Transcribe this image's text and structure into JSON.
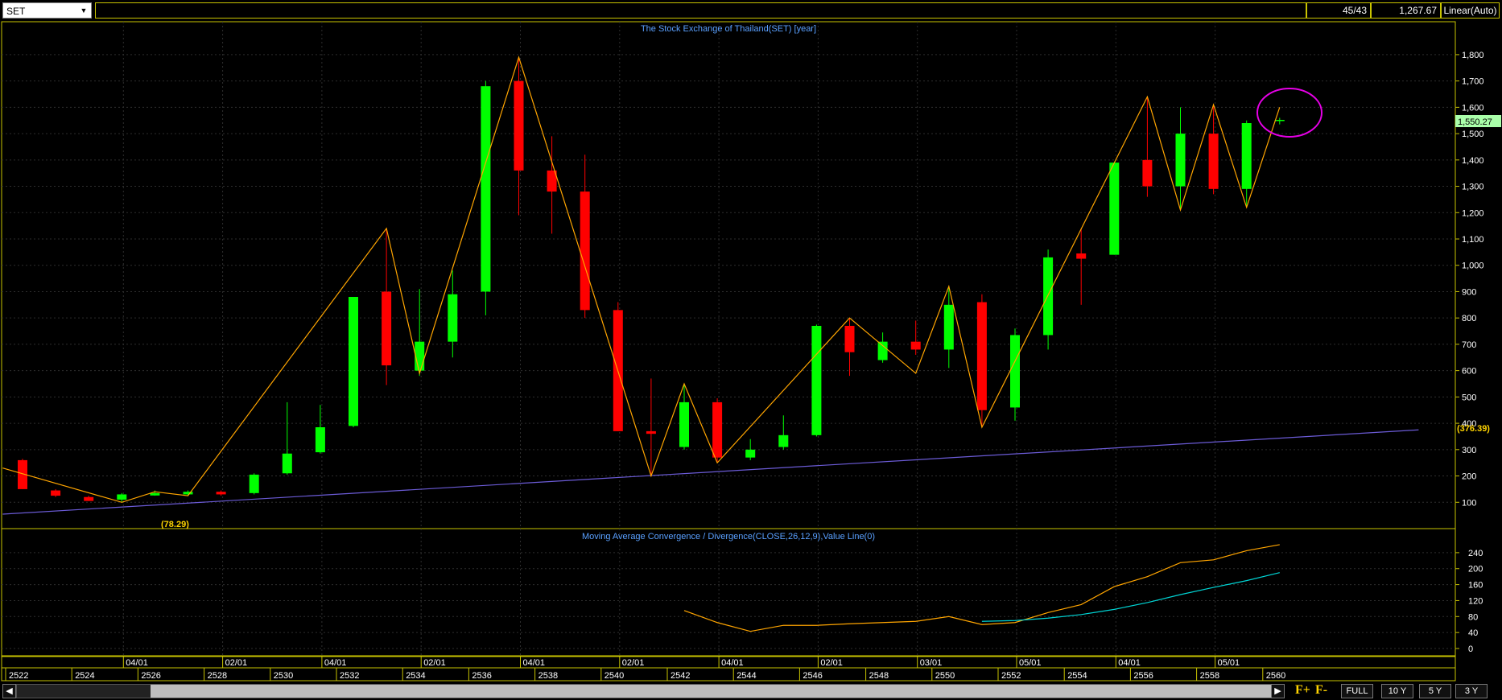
{
  "toolbar": {
    "symbol": "SET",
    "count": "45/43",
    "value": "1,267.67",
    "scale": "Linear(Auto)"
  },
  "chart_data": [
    {
      "type": "candlestick",
      "title": "The Stock Exchange of Thailand(SET) [year]",
      "x_labels_year": [
        "2522",
        "2524",
        "2526",
        "2528",
        "2530",
        "2532",
        "2534",
        "2536",
        "2538",
        "2540",
        "2542",
        "2544",
        "2546",
        "2548",
        "2550",
        "2552",
        "2554",
        "2556",
        "2558",
        "2560"
      ],
      "x_labels_date": [
        "04/01",
        "02/01",
        "04/01",
        "02/01",
        "04/01",
        "02/01",
        "04/01",
        "02/01",
        "03/01",
        "05/01",
        "04/01",
        "05/01"
      ],
      "y_ticks": [
        100,
        200,
        300,
        400,
        500,
        600,
        700,
        800,
        900,
        1000,
        1100,
        1200,
        1300,
        1400,
        1500,
        1600,
        1700,
        1800
      ],
      "ylim": [
        0,
        1870
      ],
      "candles": [
        {
          "year": 2522,
          "open": 260,
          "high": 265,
          "low": 150,
          "close": 150
        },
        {
          "year": 2523,
          "open": 145,
          "high": 150,
          "low": 120,
          "close": 125
        },
        {
          "year": 2524,
          "open": 120,
          "high": 125,
          "low": 105,
          "close": 105
        },
        {
          "year": 2525,
          "open": 110,
          "high": 135,
          "low": 100,
          "close": 130
        },
        {
          "year": 2526,
          "open": 130,
          "high": 145,
          "low": 125,
          "close": 135
        },
        {
          "year": 2527,
          "open": 130,
          "high": 145,
          "low": 125,
          "close": 140
        },
        {
          "year": 2528,
          "open": 140,
          "high": 145,
          "low": 125,
          "close": 130
        },
        {
          "year": 2529,
          "open": 135,
          "high": 210,
          "low": 130,
          "close": 205
        },
        {
          "year": 2530,
          "open": 210,
          "high": 480,
          "low": 205,
          "close": 285
        },
        {
          "year": 2531,
          "open": 290,
          "high": 470,
          "low": 285,
          "close": 385
        },
        {
          "year": 2532,
          "open": 390,
          "high": 880,
          "low": 385,
          "close": 880
        },
        {
          "year": 2533,
          "open": 900,
          "high": 1140,
          "low": 545,
          "close": 620
        },
        {
          "year": 2534,
          "open": 600,
          "high": 910,
          "low": 580,
          "close": 710
        },
        {
          "year": 2535,
          "open": 710,
          "high": 980,
          "low": 650,
          "close": 890
        },
        {
          "year": 2536,
          "open": 900,
          "high": 1700,
          "low": 810,
          "close": 1680
        },
        {
          "year": 2537,
          "open": 1700,
          "high": 1790,
          "low": 1190,
          "close": 1360
        },
        {
          "year": 2538,
          "open": 1360,
          "high": 1490,
          "low": 1120,
          "close": 1280
        },
        {
          "year": 2539,
          "open": 1280,
          "high": 1420,
          "low": 800,
          "close": 830
        },
        {
          "year": 2540,
          "open": 830,
          "high": 860,
          "low": 370,
          "close": 370
        },
        {
          "year": 2541,
          "open": 370,
          "high": 570,
          "low": 200,
          "close": 360
        },
        {
          "year": 2542,
          "open": 310,
          "high": 550,
          "low": 300,
          "close": 480
        },
        {
          "year": 2543,
          "open": 480,
          "high": 495,
          "low": 250,
          "close": 270
        },
        {
          "year": 2544,
          "open": 270,
          "high": 340,
          "low": 260,
          "close": 300
        },
        {
          "year": 2545,
          "open": 310,
          "high": 430,
          "low": 300,
          "close": 355
        },
        {
          "year": 2546,
          "open": 355,
          "high": 775,
          "low": 350,
          "close": 770
        },
        {
          "year": 2547,
          "open": 770,
          "high": 800,
          "low": 580,
          "close": 670
        },
        {
          "year": 2548,
          "open": 640,
          "high": 745,
          "low": 630,
          "close": 710
        },
        {
          "year": 2549,
          "open": 710,
          "high": 790,
          "low": 660,
          "close": 680
        },
        {
          "year": 2550,
          "open": 680,
          "high": 920,
          "low": 610,
          "close": 850
        },
        {
          "year": 2551,
          "open": 860,
          "high": 890,
          "low": 385,
          "close": 450
        },
        {
          "year": 2552,
          "open": 460,
          "high": 760,
          "low": 410,
          "close": 735
        },
        {
          "year": 2553,
          "open": 735,
          "high": 1060,
          "low": 680,
          "close": 1030
        },
        {
          "year": 2554,
          "open": 1045,
          "high": 1140,
          "low": 850,
          "close": 1025
        },
        {
          "year": 2555,
          "open": 1040,
          "high": 1390,
          "low": 1040,
          "close": 1390
        },
        {
          "year": 2556,
          "open": 1400,
          "high": 1640,
          "low": 1260,
          "close": 1300
        },
        {
          "year": 2557,
          "open": 1300,
          "high": 1600,
          "low": 1210,
          "close": 1500
        },
        {
          "year": 2558,
          "open": 1500,
          "high": 1610,
          "low": 1270,
          "close": 1290
        },
        {
          "year": 2559,
          "open": 1290,
          "high": 1550,
          "low": 1220,
          "close": 1540
        },
        {
          "year": 2560,
          "open": 1545,
          "high": 1560,
          "low": 1535,
          "close": 1550
        }
      ],
      "zigzag": [
        [
          2521.4,
          230
        ],
        [
          2525,
          100
        ],
        [
          2526,
          140
        ],
        [
          2527,
          125
        ],
        [
          2533,
          1140
        ],
        [
          2534,
          590
        ],
        [
          2537,
          1790
        ],
        [
          2541,
          200
        ],
        [
          2542,
          550
        ],
        [
          2543,
          250
        ],
        [
          2547,
          800
        ],
        [
          2549,
          590
        ],
        [
          2550,
          920
        ],
        [
          2551,
          385
        ],
        [
          2556,
          1640
        ],
        [
          2557,
          1210
        ],
        [
          2558,
          1610
        ],
        [
          2559,
          1220
        ],
        [
          2560,
          1600
        ]
      ],
      "trendline": {
        "start": [
          2521.4,
          55
        ],
        "end": [
          2564.2,
          375
        ]
      },
      "annotations": [
        "(78.29)",
        "(376.39)"
      ],
      "last_value_label": "1,550.27",
      "highlight": "ellipse around year 2560 candle",
      "colors": {
        "up": "#00ff00",
        "down": "#ff0000",
        "zigzag": "#ffa500",
        "trend": "#6b5bd6",
        "grid": "#333333",
        "axis_text": "#ffffff",
        "title": "#5aa0ff"
      }
    },
    {
      "type": "line",
      "title": "Moving Average Convergence / Divergence(CLOSE,26,12,9),Value Line(0)",
      "y_ticks": [
        0,
        40,
        80,
        120,
        160,
        200,
        240
      ],
      "ylim": [
        0,
        270
      ],
      "series": [
        {
          "color": "#ffa500",
          "points": [
            [
              2542,
              95
            ],
            [
              2543,
              65
            ],
            [
              2544,
              43
            ],
            [
              2545,
              58
            ],
            [
              2546,
              58
            ],
            [
              2547,
              62
            ],
            [
              2548,
              65
            ],
            [
              2549,
              68
            ],
            [
              2550,
              80
            ],
            [
              2551,
              60
            ],
            [
              2552,
              65
            ],
            [
              2553,
              90
            ],
            [
              2554,
              110
            ],
            [
              2555,
              155
            ],
            [
              2556,
              180
            ],
            [
              2557,
              215
            ],
            [
              2558,
              222
            ],
            [
              2559,
              245
            ],
            [
              2560,
              260
            ]
          ]
        },
        {
          "color": "#00d5d5",
          "points": [
            [
              2551,
              68
            ],
            [
              2552,
              70
            ],
            [
              2553,
              76
            ],
            [
              2554,
              85
            ],
            [
              2555,
              98
            ],
            [
              2556,
              115
            ],
            [
              2557,
              135
            ],
            [
              2558,
              153
            ],
            [
              2559,
              170
            ],
            [
              2560,
              190
            ]
          ]
        }
      ]
    }
  ],
  "nav": {
    "full": "FULL",
    "ten_y": "10 Y",
    "five_y": "5 Y",
    "three_y": "3 Y",
    "f_plus": "F+",
    "f_minus": "F-"
  }
}
